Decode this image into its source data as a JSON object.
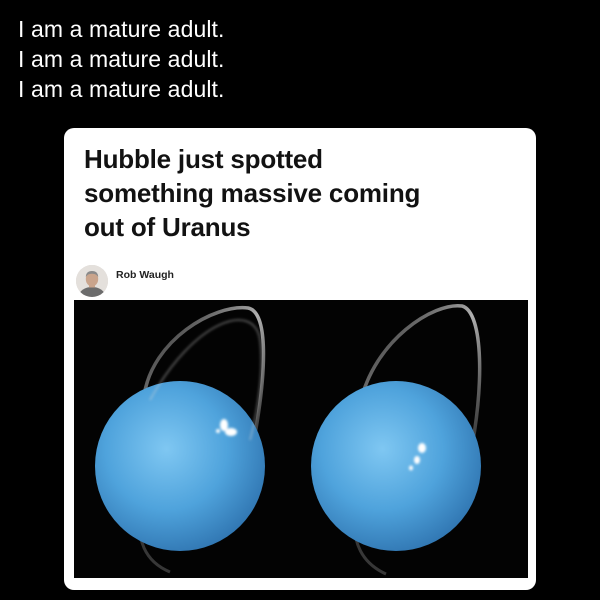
{
  "caption": {
    "lines": [
      "I am a mature adult.",
      "I am a mature adult.",
      "I am a mature adult."
    ]
  },
  "article": {
    "headline_lines": [
      "Hubble just spotted",
      "something massive coming",
      "out of Uranus"
    ],
    "author": "Rob Waugh",
    "image_description_icon": "uranus-aurora-photo"
  },
  "colors": {
    "background": "#000000",
    "card": "#ffffff",
    "planet": "#4fa3dc",
    "headline": "#121212"
  }
}
